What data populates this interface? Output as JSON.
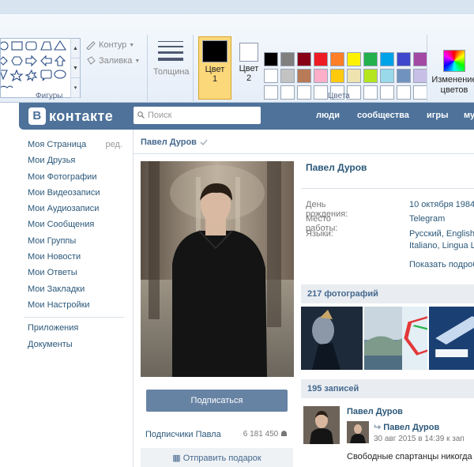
{
  "paint": {
    "groups": {
      "shapes": "Фигуры",
      "colors": "Цвета"
    },
    "tools": {
      "outline": "Контур",
      "fill": "Заливка",
      "thickness": "Толщина"
    },
    "color1": {
      "label": "Цвет",
      "num": "1",
      "value": "#000000"
    },
    "color2": {
      "label": "Цвет",
      "num": "2",
      "value": "#ffffff"
    },
    "change_colors": "Изменение цветов",
    "palette_row1": [
      "#000000",
      "#7f7f7f",
      "#880015",
      "#ed1c24",
      "#ff7f27",
      "#fff200",
      "#22b14c",
      "#00a2e8",
      "#3f48cc",
      "#a349a4"
    ],
    "palette_row2": [
      "#ffffff",
      "#c3c3c3",
      "#b97a57",
      "#ffaec9",
      "#ffc90e",
      "#efe4b0",
      "#b5e61d",
      "#99d9ea",
      "#7092be",
      "#c8bfe7"
    ]
  },
  "vk": {
    "logo": "контакте",
    "logo_letter": "В",
    "search_placeholder": "Поиск",
    "nav": [
      "люди",
      "сообщества",
      "игры",
      "му"
    ],
    "menu": [
      "Моя Страница",
      "Мои Друзья",
      "Мои Фотографии",
      "Мои Видеозаписи",
      "Мои Аудиозаписи",
      "Мои Сообщения",
      "Мои Группы",
      "Мои Новости",
      "Мои Ответы",
      "Мои Закладки",
      "Мои Настройки"
    ],
    "menu_edit": "ред.",
    "menu_extra": [
      "Приложения",
      "Документы"
    ],
    "profile": {
      "name": "Павел Дуров",
      "birthday_label": "День рождения:",
      "birthday": "10 октября 1984",
      "work_label": "Место работы:",
      "work": "Telegram",
      "lang_label": "Языки:",
      "lang1": "Русский, English,",
      "lang2": "Italiano, Lingua La",
      "show_more": "Показать подроб"
    },
    "subscribe": "Подписаться",
    "subscribers_label": "Подписчики Павла",
    "subscribers_count": "6 181 450",
    "gift": "Отправить подарок",
    "photos_head": "217 фотографий",
    "posts_head": "195 записей",
    "post": {
      "author": "Павел Дуров",
      "repost_author": "Павел Дуров",
      "date": "30 авг 2015 в 14:39 к зап",
      "text": "Свободные спартанцы никогда не"
    }
  }
}
